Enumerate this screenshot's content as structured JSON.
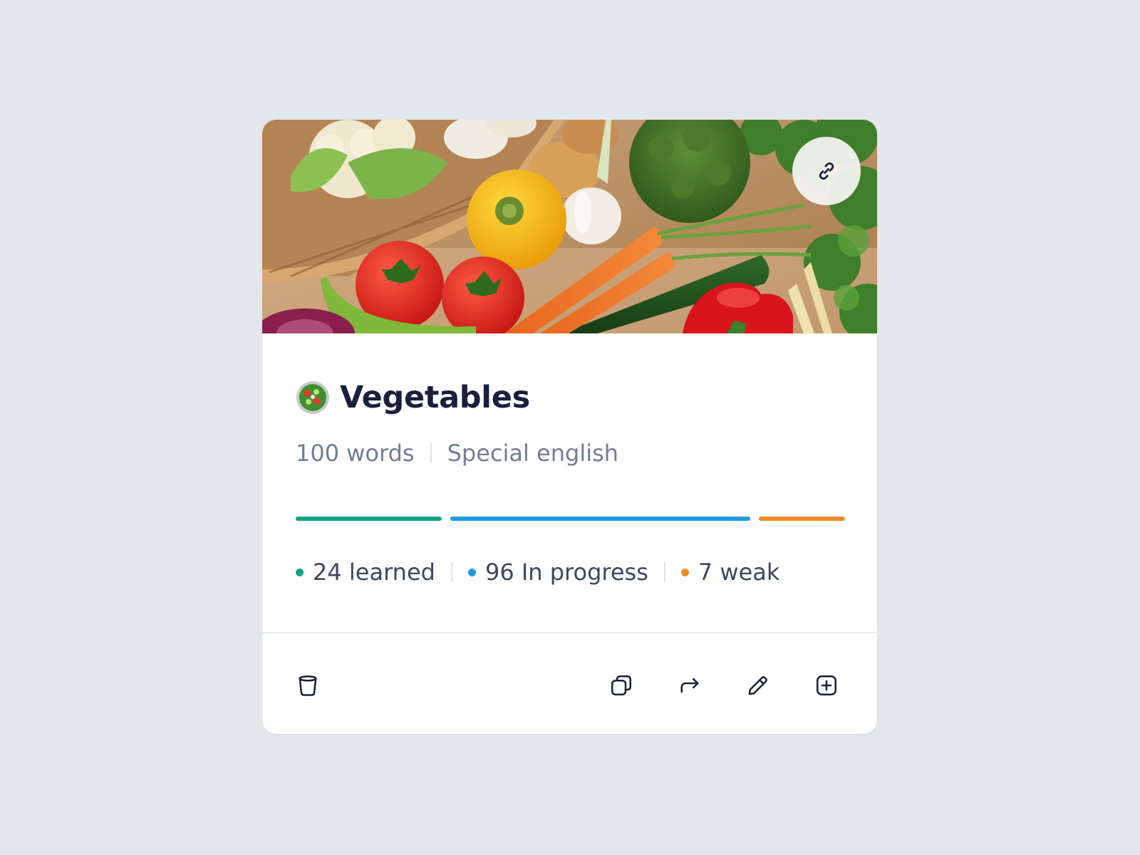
{
  "card": {
    "title": "Vegetables",
    "emoji_icon": "green-salad-emoji",
    "words": "100 words",
    "category": "Special english",
    "progress": {
      "learned_fraction": 0.266,
      "in_progress_fraction": 0.548,
      "weak_fraction": 0.157
    },
    "stats": {
      "learned": "24 learned",
      "in_progress": "96 In progress",
      "weak": "7 weak"
    },
    "colors": {
      "learned": "#16a085",
      "in_progress": "#1f9be0",
      "weak": "#f08a2c",
      "title": "#1b1f3b",
      "background": "#e3e6ea"
    },
    "actions": {
      "left": [
        "trash-icon"
      ],
      "right": [
        "copy-icon",
        "share-icon",
        "edit-icon",
        "add-square-icon"
      ]
    },
    "hero_image": "vegetables-photo",
    "hero_button_icon": "link-icon"
  }
}
